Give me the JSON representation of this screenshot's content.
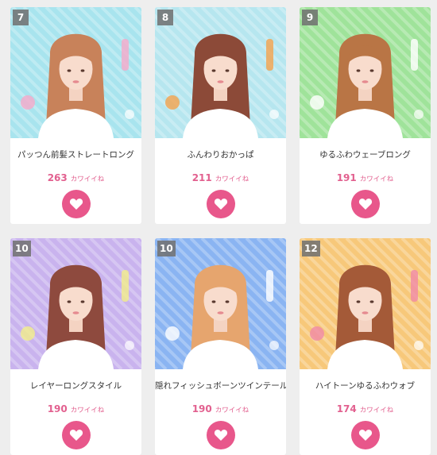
{
  "cards": [
    {
      "rank": "7",
      "title": "パッつん前髪ストレートロング",
      "likes": "263",
      "likes_unit": "カワイイね",
      "bg": "#a8e4ee",
      "accent": "#f6a9c9",
      "hair": "#c8825a"
    },
    {
      "rank": "8",
      "title": "ふんわりおかっぱ",
      "likes": "211",
      "likes_unit": "カワイイね",
      "bg": "#b6e6ef",
      "accent": "#f5a24c",
      "hair": "#8c4a38"
    },
    {
      "rank": "9",
      "title": "ゆるふわウェーブロング",
      "likes": "191",
      "likes_unit": "カワイイね",
      "bg": "#9fe39a",
      "accent": "#ffffff",
      "hair": "#b97545"
    },
    {
      "rank": "10",
      "title": "レイヤーロングスタイル",
      "likes": "190",
      "likes_unit": "カワイイね",
      "bg": "#c9b3ee",
      "accent": "#f2ee8a",
      "hair": "#8e4a3e"
    },
    {
      "rank": "10",
      "title": "隠れフィッシュボーンツインテール",
      "likes": "190",
      "likes_unit": "カワイイね",
      "bg": "#8ab4f2",
      "accent": "#ffffff",
      "hair": "#e6a56e"
    },
    {
      "rank": "12",
      "title": "ハイトーンゆるふわウォブ",
      "likes": "174",
      "likes_unit": "カワイイね",
      "bg": "#f7c87a",
      "accent": "#f08aa8",
      "hair": "#a45a38"
    }
  ],
  "colors": {
    "heart_button": "#e8578b",
    "count_text": "#e2608f"
  }
}
